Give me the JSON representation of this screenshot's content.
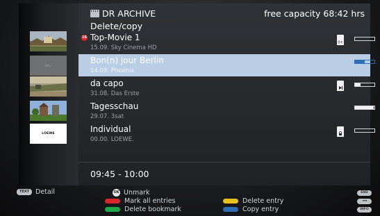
{
  "header": {
    "title": "DR ARCHIVE",
    "subtitle": "Delete/copy",
    "capacity": "free capacity 68:42 hrs"
  },
  "entries": [
    {
      "title": "Top-Movie 1",
      "meta": "15.09.  Sky Cinema HD",
      "status_icon": "child-lock-icon",
      "progress": 0.0,
      "selected": false,
      "recording_badge": true
    },
    {
      "title": "Bon(n) jour Berlin",
      "meta": "14.09.  Phoenix",
      "status_icon": "",
      "progress": 0.5,
      "selected": true,
      "recording_badge": false
    },
    {
      "title": "da capo",
      "meta": "31.08.  Das Erste",
      "status_icon": "play-continue-icon",
      "progress": 0.3,
      "selected": false,
      "recording_badge": false
    },
    {
      "title": "Tagesschau",
      "meta": "29.07.  3sat",
      "status_icon": "",
      "progress": 0.95,
      "selected": false,
      "recording_badge": false
    },
    {
      "title": "Individual",
      "meta": "00.00.  LOEWE.",
      "status_icon": "lock-icon",
      "progress": 0.0,
      "selected": false,
      "recording_badge": false
    }
  ],
  "thumbnails": {
    "dr_label": "DR+",
    "loewe_label": "LOEWE"
  },
  "time_range": "09:45 - 10:00",
  "footer": {
    "text_key": "TEXT",
    "detail": "Detail",
    "ok_key": "OK",
    "unmark": "Unmark",
    "mark_all": "Mark all entries",
    "delete_bookmark": "Delete bookmark",
    "delete_entry": "Delete entry",
    "copy_entry": "Copy entry",
    "end_key": "END",
    "rew_key": "◄◄",
    "info_key": "INFO"
  },
  "colors": {
    "selection": "#b9cde4",
    "red": "#d8262c",
    "green": "#1fa84a",
    "yellow": "#e8c21e",
    "blue": "#2d6fb5"
  }
}
